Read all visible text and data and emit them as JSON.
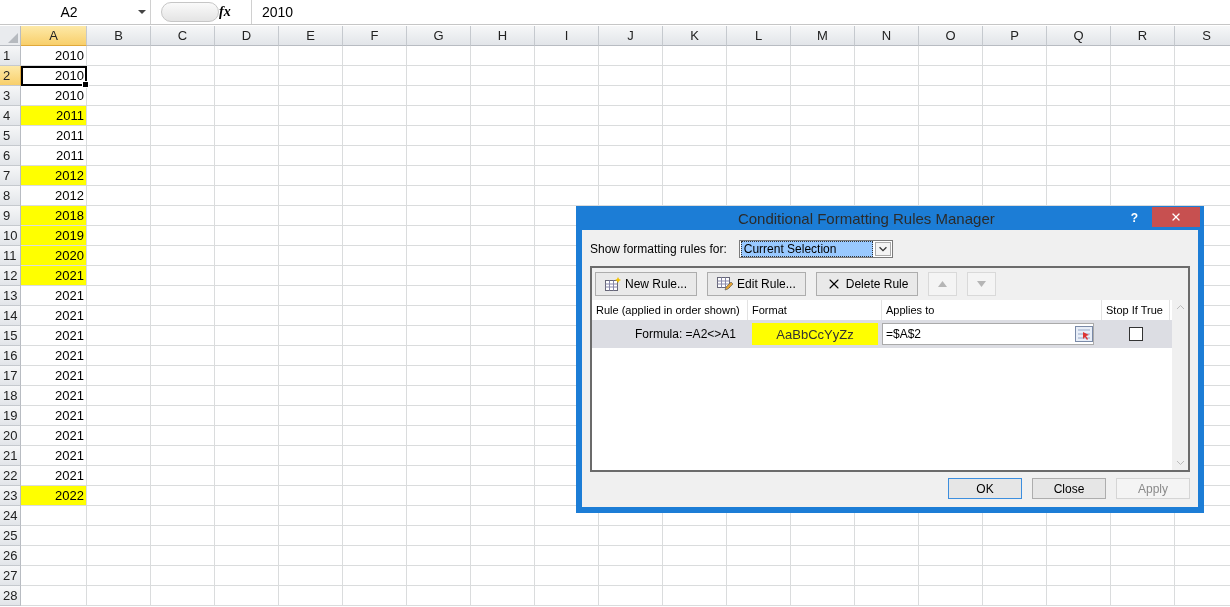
{
  "formula_bar": {
    "name_box": "A2",
    "function_label": "fx",
    "formula": "2010"
  },
  "columns": [
    {
      "label": "A",
      "selected": true
    },
    {
      "label": "B",
      "selected": false
    },
    {
      "label": "C",
      "selected": false
    },
    {
      "label": "D",
      "selected": false
    },
    {
      "label": "E",
      "selected": false
    },
    {
      "label": "F",
      "selected": false
    },
    {
      "label": "G",
      "selected": false
    },
    {
      "label": "H",
      "selected": false
    },
    {
      "label": "I",
      "selected": false
    },
    {
      "label": "J",
      "selected": false
    },
    {
      "label": "K",
      "selected": false
    },
    {
      "label": "L",
      "selected": false
    },
    {
      "label": "M",
      "selected": false
    },
    {
      "label": "N",
      "selected": false
    },
    {
      "label": "O",
      "selected": false
    },
    {
      "label": "P",
      "selected": false
    },
    {
      "label": "Q",
      "selected": false
    },
    {
      "label": "R",
      "selected": false
    },
    {
      "label": "S",
      "selected": false
    }
  ],
  "rows": [
    {
      "label": "1",
      "value": "2010",
      "highlighted": false,
      "selected": false
    },
    {
      "label": "2",
      "value": "2010",
      "highlighted": false,
      "selected": true
    },
    {
      "label": "3",
      "value": "2010",
      "highlighted": false,
      "selected": false
    },
    {
      "label": "4",
      "value": "2011",
      "highlighted": true,
      "selected": false
    },
    {
      "label": "5",
      "value": "2011",
      "highlighted": false,
      "selected": false
    },
    {
      "label": "6",
      "value": "2011",
      "highlighted": false,
      "selected": false
    },
    {
      "label": "7",
      "value": "2012",
      "highlighted": true,
      "selected": false
    },
    {
      "label": "8",
      "value": "2012",
      "highlighted": false,
      "selected": false
    },
    {
      "label": "9",
      "value": "2018",
      "highlighted": true,
      "selected": false
    },
    {
      "label": "10",
      "value": "2019",
      "highlighted": true,
      "selected": false
    },
    {
      "label": "11",
      "value": "2020",
      "highlighted": true,
      "selected": false
    },
    {
      "label": "12",
      "value": "2021",
      "highlighted": true,
      "selected": false
    },
    {
      "label": "13",
      "value": "2021",
      "highlighted": false,
      "selected": false
    },
    {
      "label": "14",
      "value": "2021",
      "highlighted": false,
      "selected": false
    },
    {
      "label": "15",
      "value": "2021",
      "highlighted": false,
      "selected": false
    },
    {
      "label": "16",
      "value": "2021",
      "highlighted": false,
      "selected": false
    },
    {
      "label": "17",
      "value": "2021",
      "highlighted": false,
      "selected": false
    },
    {
      "label": "18",
      "value": "2021",
      "highlighted": false,
      "selected": false
    },
    {
      "label": "19",
      "value": "2021",
      "highlighted": false,
      "selected": false
    },
    {
      "label": "20",
      "value": "2021",
      "highlighted": false,
      "selected": false
    },
    {
      "label": "21",
      "value": "2021",
      "highlighted": false,
      "selected": false
    },
    {
      "label": "22",
      "value": "2021",
      "highlighted": false,
      "selected": false
    },
    {
      "label": "23",
      "value": "2022",
      "highlighted": true,
      "selected": false
    },
    {
      "label": "24",
      "highlighted": false,
      "selected": false
    },
    {
      "label": "25",
      "highlighted": false,
      "selected": false
    },
    {
      "label": "26",
      "highlighted": false,
      "selected": false
    },
    {
      "label": "27",
      "highlighted": false,
      "selected": false
    },
    {
      "label": "28",
      "highlighted": false,
      "selected": false
    }
  ],
  "dialog": {
    "title": "Conditional Formatting Rules Manager",
    "help": "?",
    "show_label": "Show formatting rules for:",
    "show_value": "Current Selection",
    "toolbar": [
      {
        "kind": "new",
        "label": "New Rule...",
        "disabled": false
      },
      {
        "kind": "edit",
        "label": "Edit Rule...",
        "disabled": false
      },
      {
        "kind": "delete",
        "label": "Delete Rule",
        "disabled": false
      },
      {
        "kind": "up",
        "disabled": true
      },
      {
        "kind": "down",
        "disabled": true
      }
    ],
    "columns": [
      "Rule (applied in order shown)",
      "Format",
      "Applies to",
      "Stop If True"
    ],
    "rules": [
      {
        "rule": "Formula: =A2<>A1",
        "format_preview": "AaBbCcYyZz",
        "color": "#ffff00",
        "applies_to": "=$A$2",
        "stop_if_true": false,
        "selected": true
      }
    ],
    "buttons": [
      {
        "label": "OK",
        "default": true,
        "disabled": false
      },
      {
        "label": "Close",
        "default": false,
        "disabled": false
      },
      {
        "label": "Apply",
        "default": false,
        "disabled": true
      }
    ]
  }
}
